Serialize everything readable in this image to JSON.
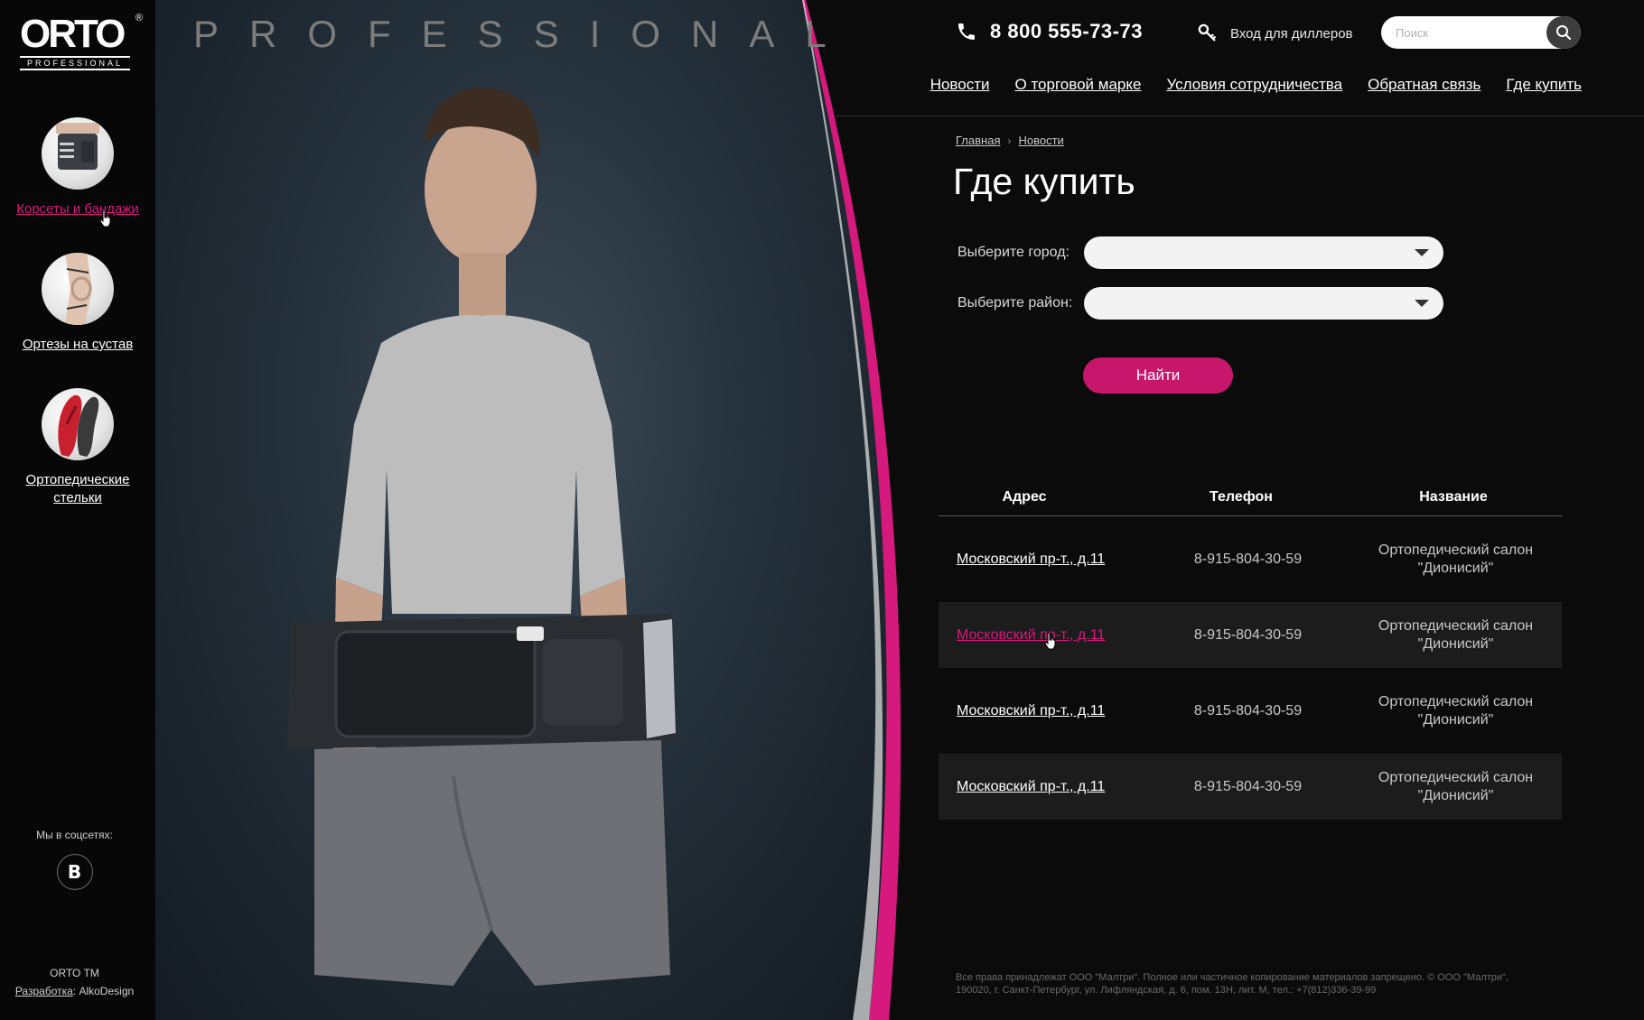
{
  "brand": {
    "logo_text": "ORTO",
    "logo_sub": "PROFESSIONAL",
    "logo_reg": "®",
    "hero_word": "PROFESSIONAL"
  },
  "sidebar": {
    "categories": [
      {
        "label": "Корсеты и бандажи",
        "icon": "corset-icon",
        "active": true
      },
      {
        "label": "Ортезы на сустав",
        "icon": "knee-brace-icon",
        "active": false
      },
      {
        "label": "Ортопедические стельки",
        "icon": "insoles-icon",
        "active": false
      }
    ],
    "social_title": "Мы в соцсетях:",
    "vk_label": "В",
    "footer_tm": "ORTO TM",
    "footer_dev_label": "Разработка",
    "footer_dev_name": ": AlkoDesign"
  },
  "header": {
    "phone": "8 800 555-73-73",
    "dealer_login": "Вход для диллеров",
    "search_placeholder": "Поиск",
    "nav": [
      "Новости",
      "О торговой марке",
      "Условия сотрудничества",
      "Обратная связь",
      "Где купить"
    ]
  },
  "breadcrumb": [
    "Главная",
    "Новости"
  ],
  "page_title": "Где купить",
  "form": {
    "city_label": "Выберите город:",
    "city_value": "",
    "district_label": "Выберите район:",
    "district_value": "",
    "submit": "Найти"
  },
  "table": {
    "headers": {
      "address": "Адрес",
      "phone": "Телефон",
      "name": "Название"
    },
    "rows": [
      {
        "address": "Московский пр-т., д.11",
        "phone": "8-915-804-30-59",
        "name_line1": "Ортопедический салон",
        "name_line2": "\"Дионисий\""
      },
      {
        "address": "Московский пр-т., д.11",
        "phone": "8-915-804-30-59",
        "name_line1": "Ортопедический салон",
        "name_line2": "\"Дионисий\""
      },
      {
        "address": "Московский пр-т., д.11",
        "phone": "8-915-804-30-59",
        "name_line1": "Ортопедический салон",
        "name_line2": "\"Дионисий\""
      },
      {
        "address": "Московский пр-т., д.11",
        "phone": "8-915-804-30-59",
        "name_line1": "Ортопедический салон",
        "name_line2": "\"Дионисий\""
      }
    ]
  },
  "copyright": "Все права принадлежат ООО \"Малтри\". Полное или частичное копирование материалов запрещено. © ООО \"Малтри\", 190020, г. Санкт-Петербург, ул. Лифляндская, д. 6, пом. 13Н, лит. М, тел.: +7(812)336-39-99",
  "colors": {
    "accent": "#d6197c",
    "button": "#c8166d",
    "background": "#0b0b0b"
  }
}
